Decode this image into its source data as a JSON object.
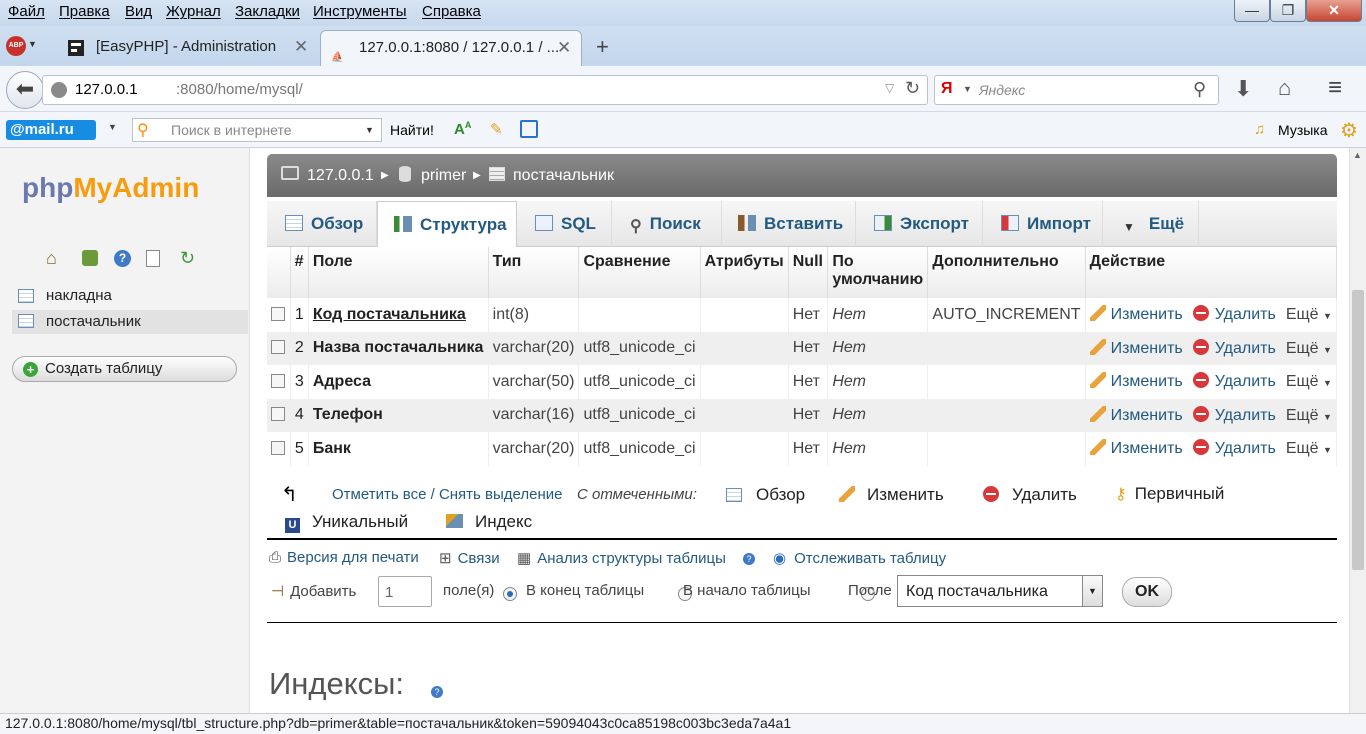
{
  "menu": [
    "Файл",
    "Правка",
    "Вид",
    "Журнал",
    "Закладки",
    "Инструменты",
    "Справка"
  ],
  "window_buttons": [
    "—",
    "❐",
    "✕"
  ],
  "tabs": [
    {
      "label": "[EasyPHP] - Administration",
      "active": false
    },
    {
      "label": "127.0.0.1:8080 / 127.0.0.1 / ...",
      "active": true
    }
  ],
  "tab_close": "✕",
  "new_tab": "+",
  "abp_badge": "ABP",
  "nav": {
    "url_host": "127.0.0.1",
    "url_rest": ":8080/home/mysql/",
    "search_placeholder": "Яндекс",
    "search_brand": "Я"
  },
  "mailbar": {
    "logo": "@mail.ru",
    "search_placeholder": "Поиск в интернете",
    "find_label": "Найти!",
    "music_label": "Музыка"
  },
  "sidebar": {
    "logo_php": "php",
    "logo_myadmin": "MyAdmin",
    "tables": [
      "накладна",
      "постачальник"
    ],
    "create_table": "Создать таблицу"
  },
  "breadcrumb": [
    "127.0.0.1",
    "primer",
    "постачальник"
  ],
  "page_tabs": [
    "Обзор",
    "Структура",
    "SQL",
    "Поиск",
    "Вставить",
    "Экспорт",
    "Импорт",
    "Ещё"
  ],
  "columns_header": [
    "#",
    "Поле",
    "Тип",
    "Сравнение",
    "Атрибуты",
    "Null",
    "По умолчанию",
    "Дополнительно",
    "Действие"
  ],
  "rows": [
    {
      "num": "1",
      "field": "Код постачальника",
      "type": "int(8)",
      "collation": "",
      "attributes": "",
      "null": "Нет",
      "default": "Нет",
      "extra": "AUTO_INCREMENT"
    },
    {
      "num": "2",
      "field": "Назва постачальника",
      "type": "varchar(20)",
      "collation": "utf8_unicode_ci",
      "attributes": "",
      "null": "Нет",
      "default": "Нет",
      "extra": ""
    },
    {
      "num": "3",
      "field": "Адреса",
      "type": "varchar(50)",
      "collation": "utf8_unicode_ci",
      "attributes": "",
      "null": "Нет",
      "default": "Нет",
      "extra": ""
    },
    {
      "num": "4",
      "field": "Телефон",
      "type": "varchar(16)",
      "collation": "utf8_unicode_ci",
      "attributes": "",
      "null": "Нет",
      "default": "Нет",
      "extra": ""
    },
    {
      "num": "5",
      "field": "Банк",
      "type": "varchar(20)",
      "collation": "utf8_unicode_ci",
      "attributes": "",
      "null": "Нет",
      "default": "Нет",
      "extra": ""
    }
  ],
  "row_actions": {
    "edit": "Изменить",
    "delete": "Удалить",
    "more": "Ещё"
  },
  "with_selected": {
    "check_all": "Отметить все / Снять выделение",
    "label": "С отмеченными:",
    "browse": "Обзор",
    "edit": "Изменить",
    "delete": "Удалить",
    "primary": "Первичный",
    "unique": "Уникальный",
    "index": "Индекс"
  },
  "links": {
    "print": "Версия для печати",
    "relations": "Связи",
    "analyze": "Анализ структуры таблицы",
    "track": "Отслеживать таблицу"
  },
  "add_fields": {
    "add_label": "Добавить",
    "count": "1",
    "fields_label": "поле(я)",
    "at_end": "В конец таблицы",
    "at_begin": "В начало таблицы",
    "after": "После",
    "after_field": "Код постачальника",
    "ok": "OK"
  },
  "indexes_heading": "Индексы:",
  "status_url": "127.0.0.1:8080/home/mysql/tbl_structure.php?db=primer&table=постачальник&token=59094043c0ca85198c003bc3eda7a4a1",
  "colors": {
    "link": "#235a81",
    "accent_orange": "#ff8c00",
    "mailru_blue": "#168de2"
  }
}
